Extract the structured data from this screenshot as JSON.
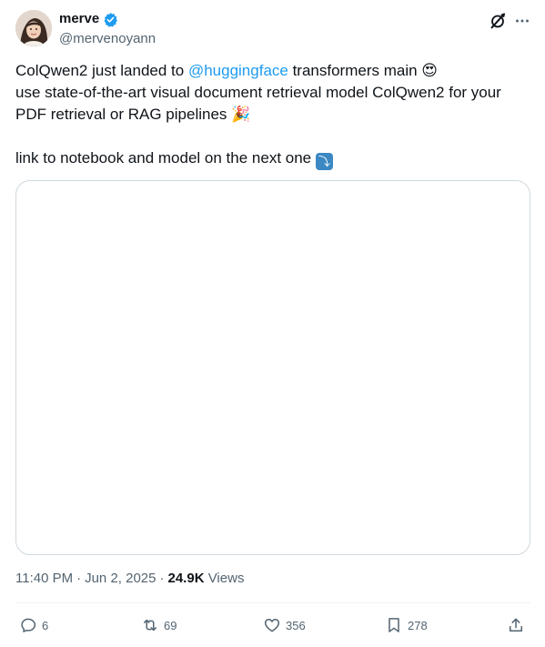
{
  "author": {
    "display_name": "merve",
    "handle": "@mervenoyann",
    "verified": true,
    "verified_color": "#1d9bf0"
  },
  "header_icons": {
    "grok": "grok-icon",
    "more": "more-icon"
  },
  "tweet": {
    "line1_before": "ColQwen2 just landed to ",
    "mention": "@huggingface",
    "line1_after": " transformers main ",
    "line1_emoji": "😍",
    "line2": "use state-of-the-art visual document retrieval model ColQwen2 for your PDF retrieval or RAG pipelines ",
    "line2_emoji": "🎉",
    "line3": "link to notebook and model on the next one ",
    "line3_emoji": "⤵"
  },
  "meta": {
    "time": "11:40 PM",
    "date": "Jun 2, 2025",
    "views_count": "24.9K",
    "views_label": "Views"
  },
  "actions": {
    "replies": "6",
    "reposts": "69",
    "likes": "356",
    "bookmarks": "278"
  },
  "colors": {
    "text": "#0f1419",
    "secondary": "#536471",
    "accent": "#1d9bf0",
    "border": "#cfd9de"
  }
}
